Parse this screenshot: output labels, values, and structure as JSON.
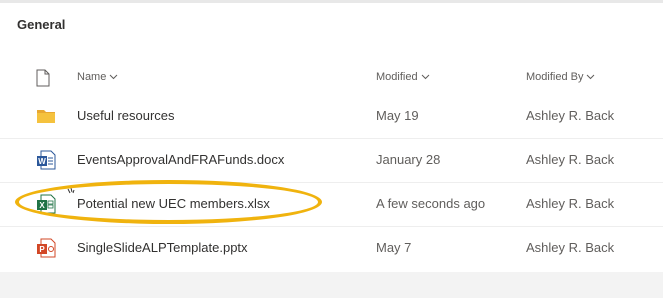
{
  "library": {
    "title": "General"
  },
  "columns": {
    "name": "Name",
    "modified": "Modified",
    "modified_by": "Modified By"
  },
  "files": [
    {
      "icon": "folder-icon",
      "name": "Useful resources",
      "modified": "May 19",
      "modified_by": "Ashley R. Back"
    },
    {
      "icon": "word-icon",
      "name": "EventsApprovalAndFRAFunds.docx",
      "modified": "January 28",
      "modified_by": "Ashley R. Back"
    },
    {
      "icon": "excel-icon",
      "name": "Potential new UEC members.xlsx",
      "modified": "A few seconds ago",
      "modified_by": "Ashley R. Back"
    },
    {
      "icon": "powerpoint-icon",
      "name": "SingleSlideALPTemplate.pptx",
      "modified": "May 7",
      "modified_by": "Ashley R. Back"
    }
  ],
  "colors": {
    "highlight": "#f0b30e",
    "folder": "#f5c23e",
    "word": "#2b579a",
    "excel": "#217346",
    "powerpoint": "#d24726"
  }
}
